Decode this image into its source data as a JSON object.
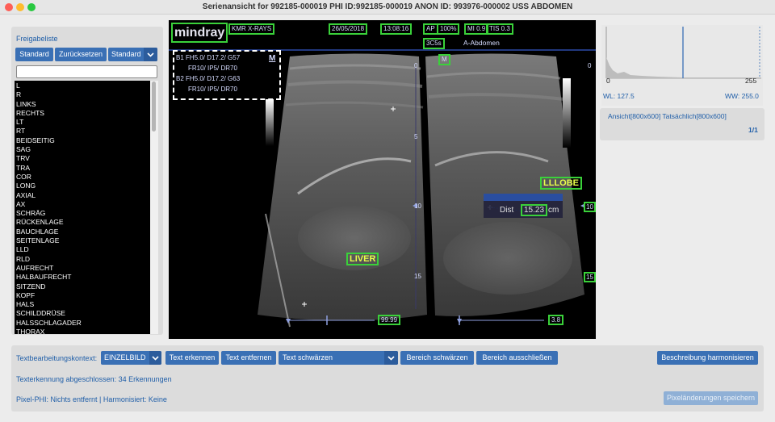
{
  "window": {
    "title": "Serienansicht for 992185-000019 PHI ID:992185-000019 ANON ID: 993976-000002 USS ABDOMEN"
  },
  "left_panel": {
    "label": "Freigabeliste",
    "btn_standard": "Standard",
    "btn_reset": "Zurücksetzen",
    "dropdown_value": "Standard",
    "search_placeholder": "",
    "items": [
      "L",
      "R",
      "LINKS",
      "RECHTS",
      "LT",
      "RT",
      "BEIDSEITIG",
      "SAG",
      "TRV",
      "TRA",
      "COR",
      "LONG",
      "AXIAL",
      "AX",
      "SCHRÄG",
      "RÜCKENLAGE",
      "BAUCHLAGE",
      "SEITENLAGE",
      "LLD",
      "RLD",
      "AUFRECHT",
      "HALBAUFRECHT",
      "SITZEND",
      "KOPF",
      "HALS",
      "SCHILDDRÜSE",
      "HALSSCHLAGADER",
      "THORAX"
    ]
  },
  "image": {
    "brand": "mindray",
    "facility": "KMR X-RAYS",
    "date": "26/05/2018",
    "time": "13:08:16",
    "ap": "AP",
    "ap_value": "100%",
    "mi": "MI 0.9",
    "tis": "TIS 0.3",
    "probe": "3C5s",
    "exam": "A-Abdomen",
    "m_marker": "M",
    "b1_line1": "B1 FH5.0/   D17.2/      G57",
    "b1_line2": "FR10/      IP5/    DR70",
    "b2_line1": "B2 FH5.0/   D17.2/      G63",
    "b2_line2": "FR10/      IP5/    DR70",
    "depth_0a": "0",
    "depth_0b": "0",
    "depth_5": "5",
    "depth_10": "10",
    "depth_10b": "10",
    "depth_15": "15",
    "depth_15b": "15",
    "label_liver": "LIVER",
    "label_lllobe": "LLLOBE",
    "dist_label": "Dist",
    "dist_value": "15.23",
    "dist_unit": "cm",
    "bottom_left_value": "99.99",
    "bottom_right_value": "3.8"
  },
  "right_panel": {
    "hist_min": "0",
    "hist_max": "255",
    "wl": "WL: 127.5",
    "ww": "WW: 255.0",
    "view_info": "Ansicht[800x600] Tatsächlich[800x600]",
    "page": "1/1"
  },
  "bottom_panel": {
    "context_label": "Textbearbeitungskontext:",
    "context_value": "EINZELBILD",
    "btn_detect": "Text erkennen",
    "btn_remove": "Text entfernen",
    "redact_dropdown": "Text schwärzen",
    "btn_redact_area": "Bereich schwärzen",
    "btn_exclude_area": "Bereich ausschließen",
    "btn_harmonize": "Beschreibung harmonisieren",
    "status_detect": "Texterkennung abgeschlossen: 34 Erkennungen",
    "status_phi": "Pixel-PHI: Nichts entfernt | Harmonisiert: Keine",
    "btn_save": "Pixeländerungen speichern"
  },
  "colors": {
    "accent": "#3a70b5",
    "link_text": "#1f5ea8",
    "detection_box": "#3ad13a",
    "annotation_text": "#e8ff4a"
  }
}
